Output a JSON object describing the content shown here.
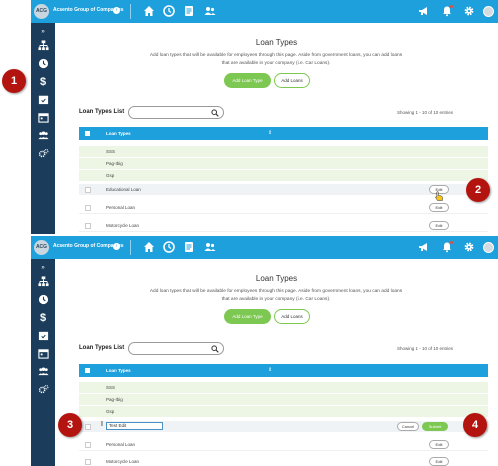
{
  "header": {
    "logo_text": "ACG",
    "company_name": "Acsento Group of Companies",
    "company_caret": "›"
  },
  "page": {
    "title": "Loan Types",
    "description_line1": "Add loan types that will be available for employees through this page. Aside from government loans, you can add loans",
    "description_line2": "that are available in your company (i.e. Car Loans).",
    "add_loan_type_label": "Add Loan Type",
    "add_loans_label": "Add Loans",
    "list_title": "Loan Types List",
    "search_placeholder": "",
    "showing_text": "Showing 1 - 10 of 10 entries",
    "column_header": "Loan Types",
    "sort_icon": "⇕",
    "edit_label": "Edit",
    "cancel_label": "Cancel",
    "submit_label": "Submit",
    "edit_input_value": "Test Edit"
  },
  "rows_frame1": [
    {
      "label": "SSS"
    },
    {
      "label": "Pag-Ibig"
    },
    {
      "label": "Gsp"
    },
    {
      "label": "Educational Loan"
    },
    {
      "label": "Personal Loan"
    },
    {
      "label": "Motorcycle Loan"
    }
  ],
  "rows_frame2": [
    {
      "label": "SSS"
    },
    {
      "label": "Pag-Ibig"
    },
    {
      "label": "Gsp"
    },
    {
      "label": "Personal Loan"
    },
    {
      "label": "Motorcycle Loan"
    }
  ],
  "markers": {
    "m1": "1",
    "m2": "2",
    "m3": "3",
    "m4": "4"
  },
  "colors": {
    "topbar": "#1ea0dc",
    "sidebar": "#1b3d5b",
    "green": "#7dc852",
    "marker": "#b3140f"
  }
}
